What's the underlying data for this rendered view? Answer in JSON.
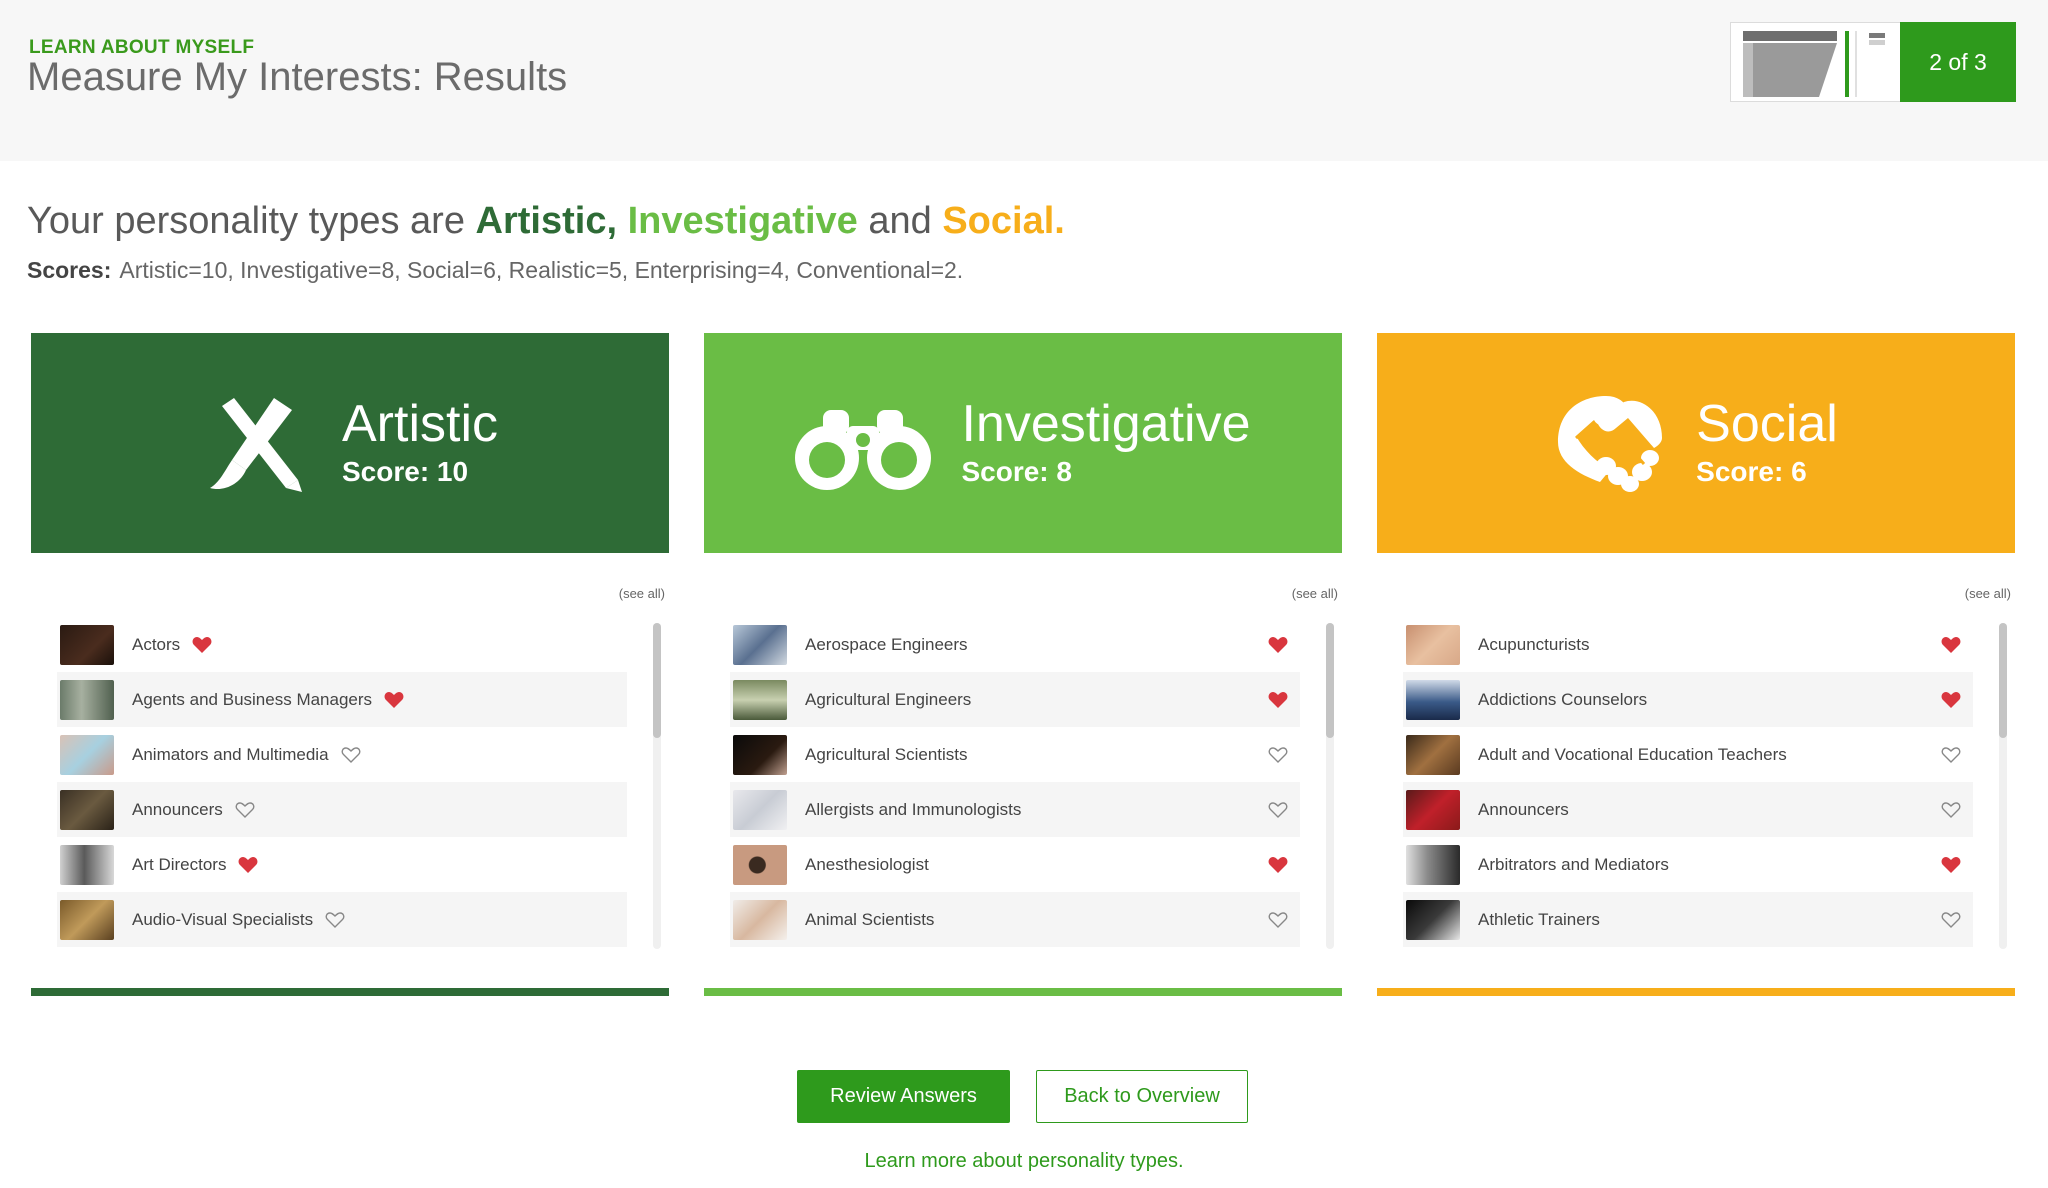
{
  "header": {
    "eyebrow": "LEARN ABOUT MYSELF",
    "title": "Measure My Interests: Results",
    "step_label": "2 of 3"
  },
  "headline": {
    "prefix": "Your personality types are",
    "type1": "Artistic,",
    "type2": "Investigative",
    "and": "and",
    "type3": "Social."
  },
  "scores": {
    "label": "Scores:",
    "text": "Artistic=10, Investigative=8, Social=6, Realistic=5, Enterprising=4, Conventional=2."
  },
  "colors": {
    "artistic": "#2e6b36",
    "investigative": "#6abd45",
    "social": "#f7ae1a",
    "primary_green": "#2e9a1c",
    "heart_filled": "#d9363e"
  },
  "cards": [
    {
      "name": "Artistic",
      "score_label": "Score: 10",
      "icon": "pencil-brush-icon",
      "see_all": "(see all)",
      "items": [
        {
          "label": "Actors",
          "favorite": true
        },
        {
          "label": "Agents and Business Managers",
          "favorite": true
        },
        {
          "label": "Animators and Multimedia",
          "favorite": false
        },
        {
          "label": "Announcers",
          "favorite": false
        },
        {
          "label": "Art Directors",
          "favorite": true
        },
        {
          "label": "Audio-Visual Specialists",
          "favorite": false
        }
      ]
    },
    {
      "name": "Investigative",
      "score_label": "Score: 8",
      "icon": "binoculars-icon",
      "see_all": "(see all)",
      "items": [
        {
          "label": "Aerospace Engineers",
          "favorite": true
        },
        {
          "label": "Agricultural Engineers",
          "favorite": true
        },
        {
          "label": "Agricultural Scientists",
          "favorite": false
        },
        {
          "label": "Allergists and Immunologists",
          "favorite": false
        },
        {
          "label": "Anesthesiologist",
          "favorite": true
        },
        {
          "label": "Animal Scientists",
          "favorite": false
        }
      ]
    },
    {
      "name": "Social",
      "score_label": "Score: 6",
      "icon": "handshake-icon",
      "see_all": "(see all)",
      "items": [
        {
          "label": "Acupuncturists",
          "favorite": true
        },
        {
          "label": "Addictions Counselors",
          "favorite": true
        },
        {
          "label": "Adult and Vocational Education Teachers",
          "favorite": false
        },
        {
          "label": "Announcers",
          "favorite": false
        },
        {
          "label": "Arbitrators and Mediators",
          "favorite": true
        },
        {
          "label": "Athletic Trainers",
          "favorite": false
        }
      ]
    }
  ],
  "actions": {
    "review": "Review Answers",
    "back": "Back to Overview",
    "learn_more": "Learn more about personality types."
  }
}
